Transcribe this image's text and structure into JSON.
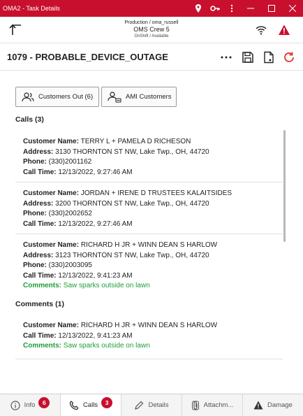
{
  "window": {
    "title": "OMA2 - Task Details",
    "icons": [
      "location-pin-icon",
      "key-icon",
      "kebab-icon"
    ],
    "controls": [
      "minimize",
      "maximize",
      "close"
    ]
  },
  "header": {
    "line1": "Production / oma_russell",
    "line2": "OMS Crew 5",
    "line3": "OnShift / Available",
    "status_icons": [
      "wifi-icon",
      "warning-icon"
    ]
  },
  "task": {
    "title": "1079 - PROBABLE_DEVICE_OUTAGE",
    "actions": [
      "more-icon",
      "save-icon",
      "document-icon",
      "refresh-icon"
    ]
  },
  "buttons": {
    "customers_out": "Customers Out (6)",
    "ami_customers": "AMI Customers"
  },
  "calls": {
    "heading": "Calls  (3)",
    "labels": {
      "name": "Customer Name:",
      "address": "Address:",
      "phone": "Phone:",
      "time": "Call Time:",
      "comments": "Comments:"
    },
    "items": [
      {
        "name": "TERRY L + PAMELA D RICHESON",
        "address": "3130 THORNTON ST NW, Lake Twp., OH, 44720",
        "phone": "(330)2001162",
        "time": "12/13/2022, 9:27:46 AM"
      },
      {
        "name": "JORDAN + IRENE D TRUSTEES KALAITSIDES",
        "address": "3200 THORNTON ST NW, Lake Twp., OH, 44720",
        "phone": "(330)2002652",
        "time": "12/13/2022, 9:27:46 AM"
      },
      {
        "name": "RICHARD H JR + WINN DEAN S HARLOW",
        "address": "3123 THORNTON ST NW, Lake Twp., OH, 44720",
        "phone": "(330)2003095",
        "time": "12/13/2022, 9:41:23 AM",
        "comments": "Saw sparks outside on lawn"
      }
    ]
  },
  "comments": {
    "heading": "Comments (1)",
    "items": [
      {
        "name": "RICHARD H JR + WINN DEAN S HARLOW",
        "time": "12/13/2022, 9:41:23 AM",
        "comments": "Saw sparks outside on lawn"
      }
    ]
  },
  "tabs": [
    {
      "label": "Info",
      "badge": "6",
      "icon": "info-icon"
    },
    {
      "label": "Calls",
      "badge": "3",
      "icon": "phone-icon",
      "active": true
    },
    {
      "label": "Details",
      "icon": "pencil-icon"
    },
    {
      "label": "Attachm...",
      "icon": "paperclip-icon"
    },
    {
      "label": "Damage",
      "icon": "warning-icon"
    }
  ],
  "colors": {
    "brand": "#c8102e",
    "comment": "#1f9c3a",
    "refresh": "#e0352b"
  }
}
